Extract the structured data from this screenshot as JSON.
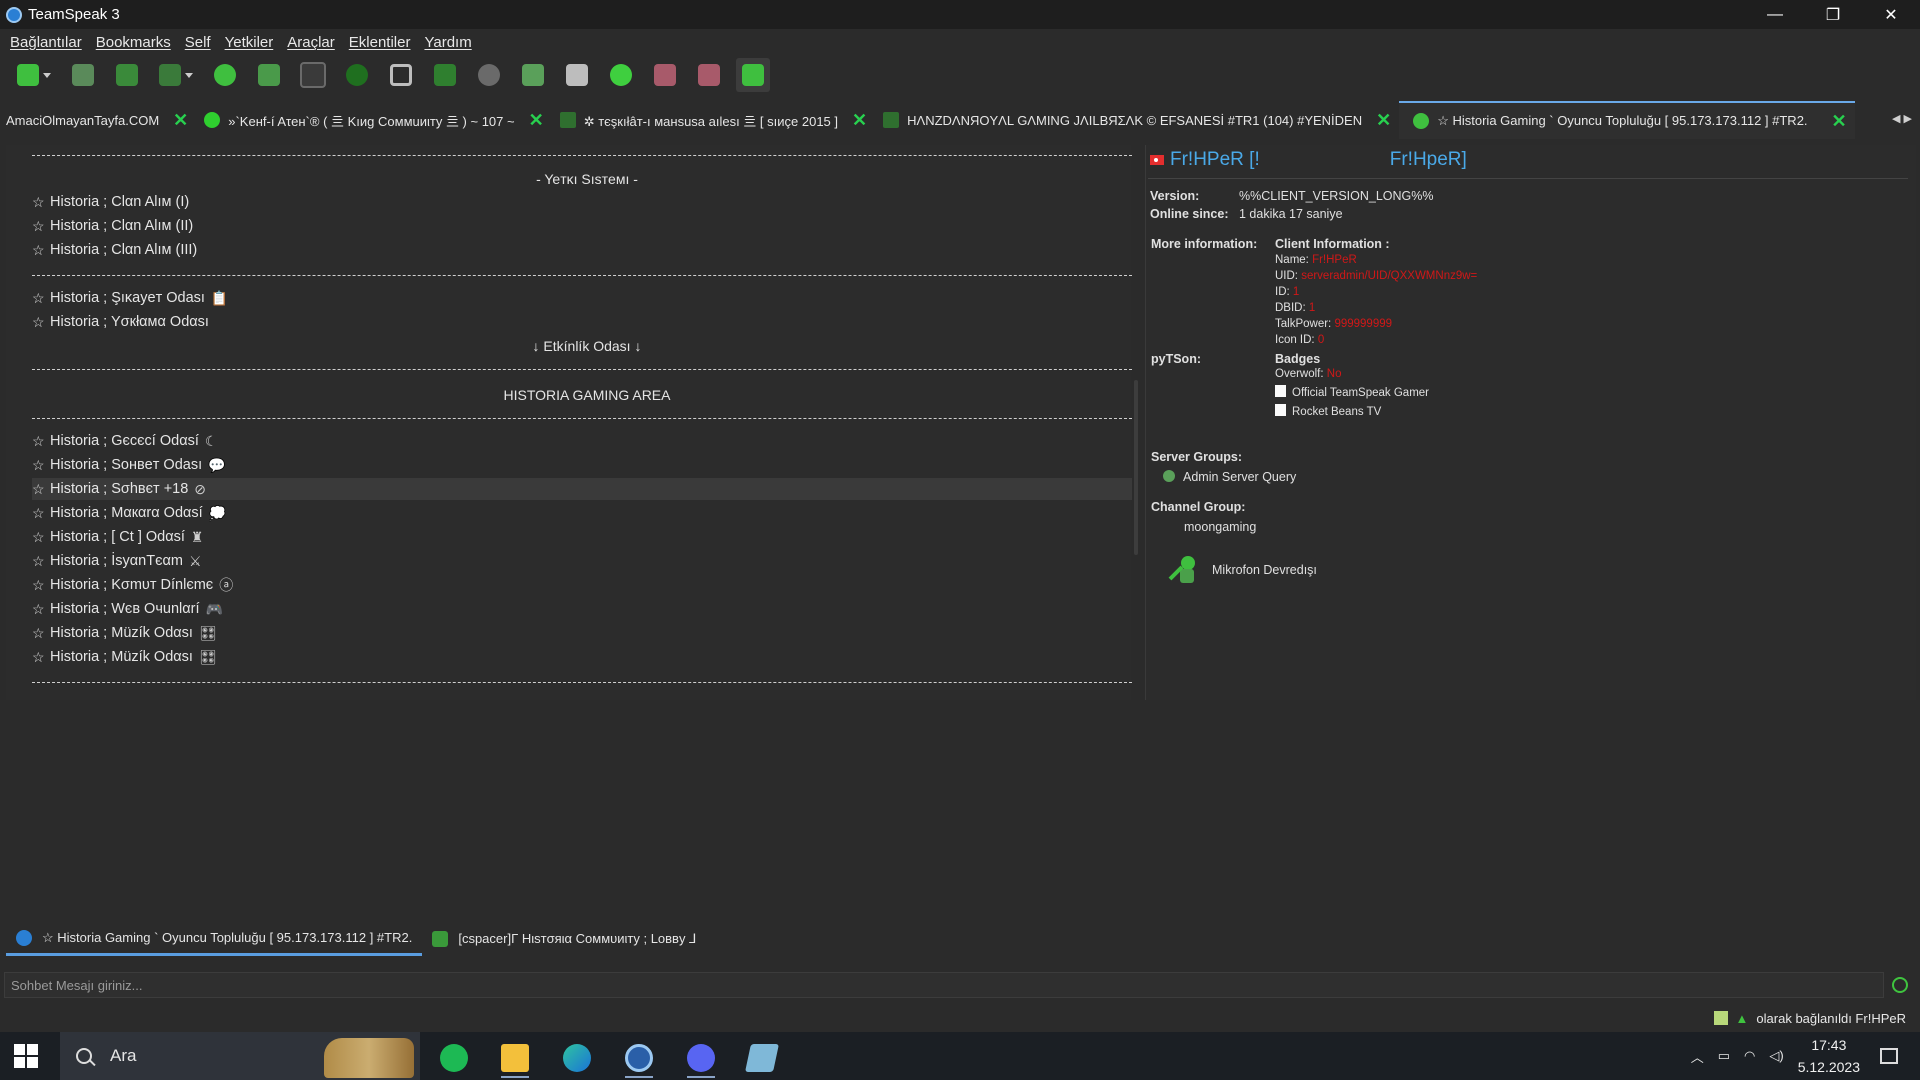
{
  "window": {
    "title": "TeamSpeak 3"
  },
  "menu": [
    "Bağlantılar",
    "Bookmarks",
    "Self",
    "Yetkiler",
    "Araçlar",
    "Eklentiler",
    "Yardım"
  ],
  "tabs": [
    {
      "label": "AmaciOlmayanTayfa.COM"
    },
    {
      "label": "»`Keнf-í Aτeн`® ( 亖 Kıиg Coммuиιтy 亖 ) ~ 107 ~"
    },
    {
      "label": "✲ тєşкıłâт-ı мaнsusa aılesı 亖 [ sıиçe 2015 ]"
    },
    {
      "label": "HΛNZDΛNЯOYΛL GΛMING JΛILBЯΣΛK © EFSANESİ #TR1 (104) #YENİDEN"
    },
    {
      "label": "☆ Historia Gaming ` Oyuncu Topluluğu [ 95.173.173.112 ] #TR2."
    }
  ],
  "close_glyph": "✕",
  "tree": {
    "section_title": "- Yeтĸı Sıѕтeмı -",
    "event_title": "↓ Etkínlík Odası ↓",
    "area_title": "HISTORIA GAMING AREA",
    "star": "☆",
    "channels_group1": [
      "Historia ; Clαn Alıм (I)",
      "Historia ; Clαn Alıм (II)",
      "Historia ; Clαn Alıм (III)"
    ],
    "channels_group2": [
      {
        "name": "Historia ; Şıĸayeт Odası",
        "icon": "📋"
      },
      {
        "name": "Historia ; Yσкłαмα Odαsı",
        "icon": ""
      }
    ],
    "channels_group3": [
      {
        "name": "Historia ; Gєcєcí Odαsí",
        "icon": "☾"
      },
      {
        "name": "Historia ; Soнвeт Odaѕı",
        "icon": "💬"
      },
      {
        "name": "Historia ; Sσhвєт +18",
        "icon": "⊘"
      },
      {
        "name": "Historia ; Mαкαrα Odαsí",
        "icon": "💭"
      },
      {
        "name": "Historia ; [ Ct ] Odαsí",
        "icon": "♜"
      },
      {
        "name": "Historia ; İsyαnTєαm",
        "icon": "⚔"
      },
      {
        "name": "Historia ; Kσmυт Dínlєmє",
        "icon": "ⓐ"
      },
      {
        "name": "Historia ; Wєв Oчunlαrí",
        "icon": "🎮"
      },
      {
        "name": "Historia ; Müzík Odαsı",
        "icon": "🎛"
      },
      {
        "name": "Historia ; Müzík Odαsı",
        "icon": "🎛"
      }
    ],
    "selected_index": 2
  },
  "client": {
    "nick_left": "Fr!HPeR [!",
    "nick_right": "Fr!HpeR]",
    "version_label": "Version:",
    "version_value": "%%CLIENT_VERSION_LONG%%",
    "online_label": "Online since:",
    "online_value": "1 dakika 17 saniye",
    "more_label": "More information:",
    "client_info_title": "Client Information :",
    "name_label": "Name:",
    "name_value": "Fr!HPeR",
    "uid_label": "UID:",
    "uid_value": "serveradmin/UID/QXXWMNnz9w=",
    "id_label": "ID:",
    "id_value": "1",
    "dbid_label": "DBID:",
    "dbid_value": "1",
    "talkpower_label": "TalkPower:",
    "talkpower_value": "999999999",
    "iconid_label": "Icon ID:",
    "iconid_value": "0",
    "pytson_label": "pyTSon:",
    "badges_title": "Badges",
    "overwolf_label": "Overwolf:",
    "overwolf_value": "No",
    "badge1": "Official TeamSpeak Gamer",
    "badge2": "Rocket Beans TV",
    "server_groups_label": "Server Groups:",
    "server_group": "Admin Server Query",
    "channel_group_label": "Channel Group:",
    "channel_group": "moongaming",
    "mic_label": "Mikrofon Devredışı"
  },
  "chat": {
    "tab_server": "☆ Historia Gaming ` Oyuncu Topluluğu [ 95.173.173.112 ] #TR2.",
    "tab_channel": "[cspacer]Γ Hιsтσяια Coммυиιтy ; Loввy ⅃",
    "input_placeholder": "Sohbet Mesajı giriniz...",
    "status_text": "olarak bağlanıldı Fr!HPeR"
  },
  "taskbar": {
    "search_text": "Ara",
    "time": "17:43",
    "date": "5.12.2023"
  },
  "colors": {
    "accent": "#4aa9e8",
    "green": "#28d04f",
    "red": "#d01818"
  }
}
